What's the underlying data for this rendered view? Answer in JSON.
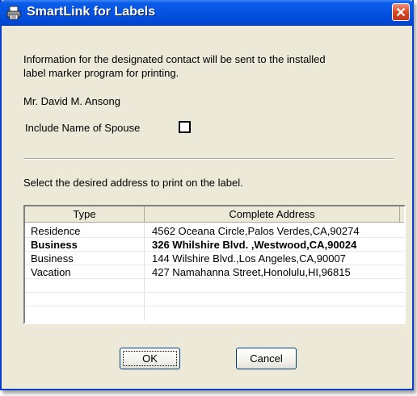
{
  "window": {
    "title": "SmartLink for Labels",
    "accent_color": "#0a5ce8",
    "close_icon": "close-icon"
  },
  "info": {
    "line1": "Information for the designated contact will be sent to the installed",
    "line2": "label marker program for printing."
  },
  "contact_name": "Mr. David M. Ansong",
  "spouse_option": {
    "label": "Include Name of Spouse",
    "checked": false
  },
  "select_instruction": "Select the desired address to print on the  label.",
  "address_list": {
    "columns": [
      "Type",
      "Complete Address"
    ],
    "rows": [
      {
        "type": "Residence",
        "address": "4562 Oceana Circle,Palos Verdes,CA,90274",
        "selected": false
      },
      {
        "type": "Business",
        "address": "326 Whilshire Blvd. ,Westwood,CA,90024",
        "selected": true
      },
      {
        "type": "Business",
        "address": "144 Wilshire Blvd.,Los Angeles,CA,90007",
        "selected": false
      },
      {
        "type": "Vacation",
        "address": "427 Namahanna Street,Honolulu,HI,96815",
        "selected": false
      }
    ]
  },
  "buttons": {
    "ok_label": "OK",
    "cancel_label": "Cancel"
  }
}
